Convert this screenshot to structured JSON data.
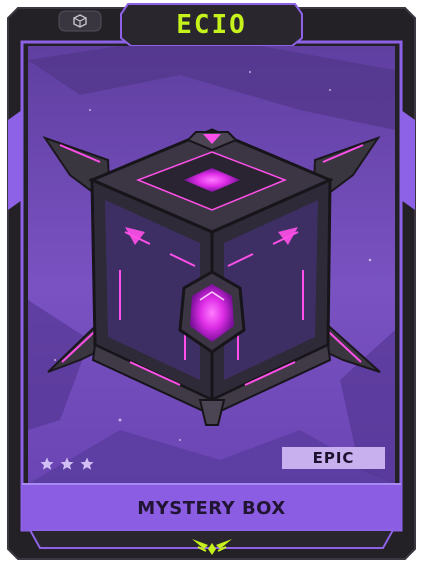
{
  "card": {
    "brand": "ECIO",
    "rarity": "EPIC",
    "title": "MYSTERY BOX",
    "star_count": 3
  },
  "icons": {
    "top_left": "cube-icon",
    "star": "star-icon",
    "bottom_emblem": "ecio-emblem-icon"
  },
  "colors": {
    "frame_dark": "#2b2730",
    "accent_purple": "#9b6ef0",
    "panel_purple": "#7a4bd9",
    "badge_bg": "#c8b0ef",
    "logo_green": "#c6f21c",
    "box_glow": "#ff3df2"
  }
}
